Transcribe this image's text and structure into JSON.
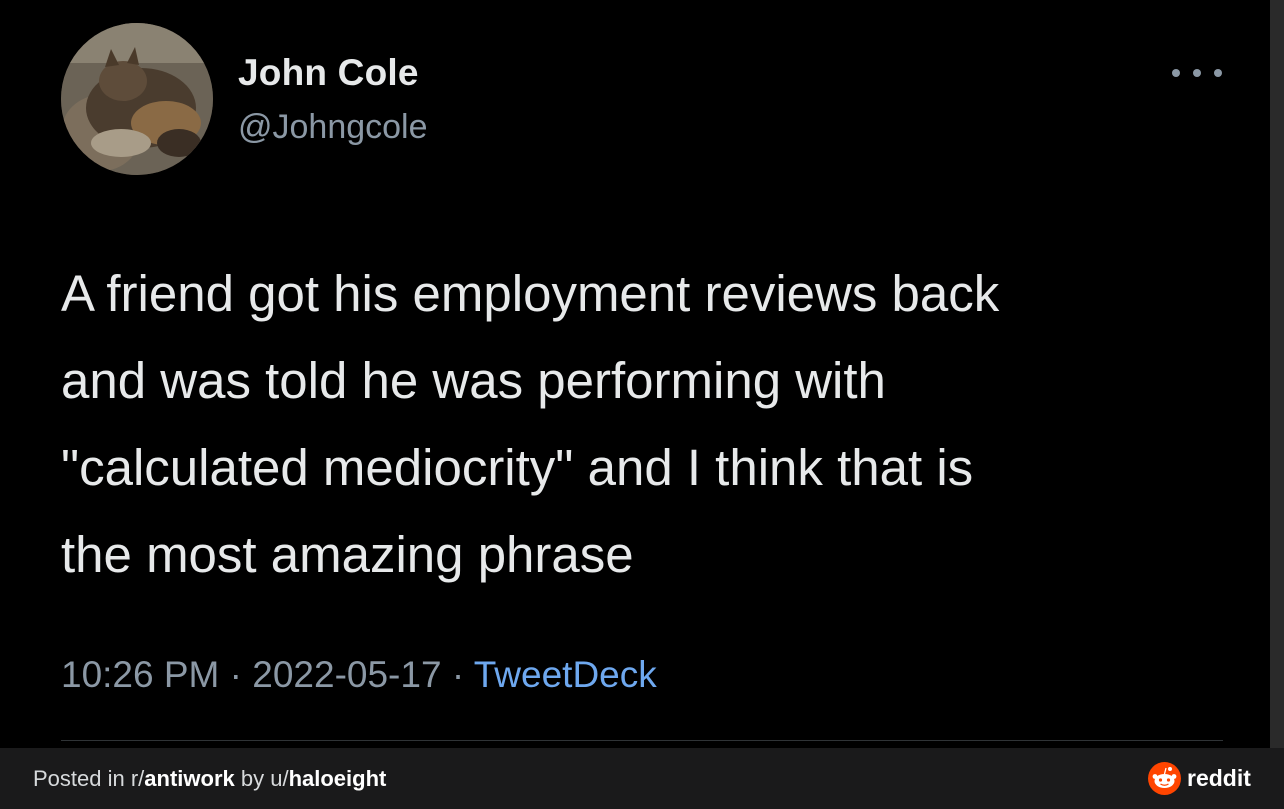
{
  "tweet": {
    "display_name": "John Cole",
    "handle": "@Johngcole",
    "text_lines": [
      "A friend got his employment reviews back",
      "and was told he was performing with",
      "\"calculated mediocrity\" and I think that is",
      "the most amazing phrase"
    ],
    "time": "10:26 PM",
    "separator": "·",
    "date": "2022-05-17",
    "source": "TweetDeck"
  },
  "footer": {
    "posted_prefix": "Posted in r/",
    "subreddit": "antiwork",
    "by_prefix": " by u/",
    "username": "haloeight",
    "brand": "reddit"
  },
  "icons": {
    "avatar": "cat-photo-avatar",
    "more": "more-options-icon",
    "brand_logo": "reddit-snoo-icon"
  },
  "colors": {
    "background": "#000000",
    "primary_text": "#e7e9ea",
    "secondary_text": "#8b98a5",
    "link": "#6ea8ef",
    "footer_bg": "#1a1a1b",
    "reddit_orange": "#ff4500"
  }
}
